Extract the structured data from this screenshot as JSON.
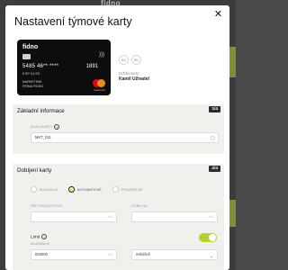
{
  "background": {
    "logo_text": "fidno",
    "accent": "#b6d431"
  },
  "modal": {
    "title": "Nastavení týmové karty",
    "close_icon": "close-icon"
  },
  "card": {
    "brand": "fidno",
    "number_masked": "5485  46**  ****",
    "last_digits": "1891",
    "expiry": "EXP 01/23",
    "line1": "MARKETING",
    "line2": "FIRMA FIDDO",
    "network": "mastercard",
    "colors": {
      "background": "#0d0d0d"
    }
  },
  "holder": {
    "avatars": [
      "KU",
      "KU"
    ],
    "label": "Držitel karty:",
    "name": "Kamil Uživatel"
  },
  "section_basic": {
    "title": "Základní informace",
    "step": "1/4",
    "alias_label": "ALIAS KARTY",
    "alias_value": "MKT_011"
  },
  "section_topup": {
    "title": "Dobíjení karty",
    "step": "2/4",
    "modes": [
      {
        "label": "MANUÁLNÍ",
        "selected": false
      },
      {
        "label": "AUTOMATICKÉ",
        "selected": true
      },
      {
        "label": "PRAVIDELNÉ",
        "selected": false
      }
    ],
    "threshold_label": "PŘI POKLESU POD:",
    "threshold_unit": "Kč",
    "topup_label": "DOBÍJ NA",
    "topup_unit": "Kč",
    "limit_label": "Limit",
    "limit_enabled": true,
    "limit_sub_label": "MAXIMÁLNÍ",
    "limit_value": "833000",
    "limit_unit": "Kč",
    "period_value": "měsíčně",
    "toggle_color": "#b7d12c"
  }
}
